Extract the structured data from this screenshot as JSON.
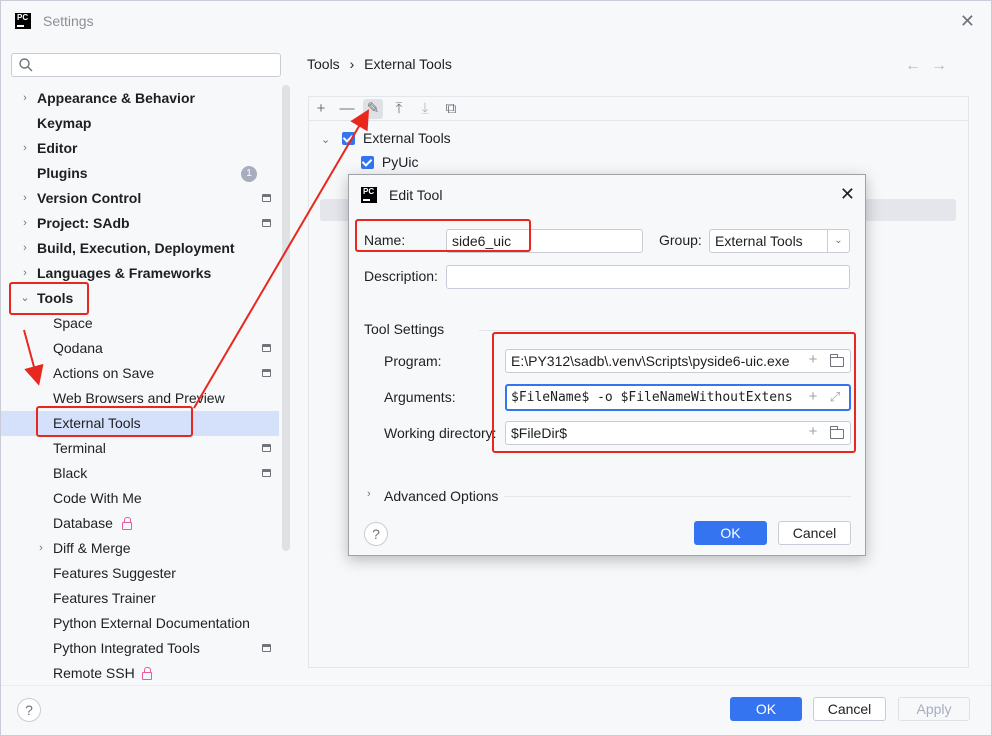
{
  "window": {
    "title": "Settings",
    "logo_text": "PC"
  },
  "search": {
    "placeholder": ""
  },
  "sidebar": {
    "items": [
      {
        "label": "Appearance & Behavior",
        "expandable": true,
        "level": 0
      },
      {
        "label": "Keymap",
        "expandable": false,
        "level": 0
      },
      {
        "label": "Editor",
        "expandable": true,
        "level": 0
      },
      {
        "label": "Plugins",
        "expandable": false,
        "level": 0,
        "badge": "1"
      },
      {
        "label": "Version Control",
        "expandable": true,
        "level": 0,
        "modified": true
      },
      {
        "label": "Project: SAdb",
        "expandable": true,
        "level": 0,
        "modified": true
      },
      {
        "label": "Build, Execution, Deployment",
        "expandable": true,
        "level": 0
      },
      {
        "label": "Languages & Frameworks",
        "expandable": true,
        "level": 0
      },
      {
        "label": "Tools",
        "expandable": true,
        "expanded": true,
        "level": 0
      },
      {
        "label": "Space",
        "level": 1
      },
      {
        "label": "Qodana",
        "level": 1,
        "modified": true
      },
      {
        "label": "Actions on Save",
        "level": 1,
        "modified": true
      },
      {
        "label": "Web Browsers and Preview",
        "level": 1
      },
      {
        "label": "External Tools",
        "level": 1,
        "selected": true
      },
      {
        "label": "Terminal",
        "level": 1,
        "modified": true
      },
      {
        "label": "Black",
        "level": 1,
        "modified": true
      },
      {
        "label": "Code With Me",
        "level": 1
      },
      {
        "label": "Database",
        "level": 1,
        "locked": true
      },
      {
        "label": "Diff & Merge",
        "level": 1,
        "expandable": true
      },
      {
        "label": "Features Suggester",
        "level": 1
      },
      {
        "label": "Features Trainer",
        "level": 1
      },
      {
        "label": "Python External Documentation",
        "level": 1
      },
      {
        "label": "Python Integrated Tools",
        "level": 1,
        "modified": true
      },
      {
        "label": "Remote SSH",
        "level": 1,
        "locked": true
      }
    ]
  },
  "breadcrumb": {
    "parent": "Tools",
    "separator": "›",
    "current": "External Tools"
  },
  "nav": {
    "back": "←",
    "forward": "→"
  },
  "toolbar": {
    "add": "+",
    "remove": "—",
    "edit": "✎",
    "move_up": "⤒",
    "move_down": "⤓",
    "copy": "⧉"
  },
  "tools_tree": {
    "group_label": "External Tools",
    "tool_label": "PyUic"
  },
  "dialog": {
    "title": "Edit Tool",
    "logo_text": "PC",
    "name_label": "Name:",
    "name_value": "side6_uic",
    "group_label": "Group:",
    "group_value": "External Tools",
    "description_label": "Description:",
    "description_value": "",
    "tool_settings_label": "Tool Settings",
    "program_label": "Program:",
    "program_value": "E:\\PY312\\sadb\\.venv\\Scripts\\pyside6-uic.exe",
    "arguments_label": "Arguments:",
    "arguments_value": "$FileName$ -o $FileNameWithoutExtens",
    "working_dir_label": "Working directory:",
    "working_dir_value": "$FileDir$",
    "advanced_label": "Advanced Options",
    "help": "?",
    "ok": "OK",
    "cancel": "Cancel"
  },
  "footer": {
    "help": "?",
    "ok": "OK",
    "cancel": "Cancel",
    "apply": "Apply"
  },
  "colors": {
    "accent": "#3574f0",
    "selection": "#d5e1fb",
    "annotation_red": "#e8281e",
    "lock_pink": "#e55b9e"
  }
}
